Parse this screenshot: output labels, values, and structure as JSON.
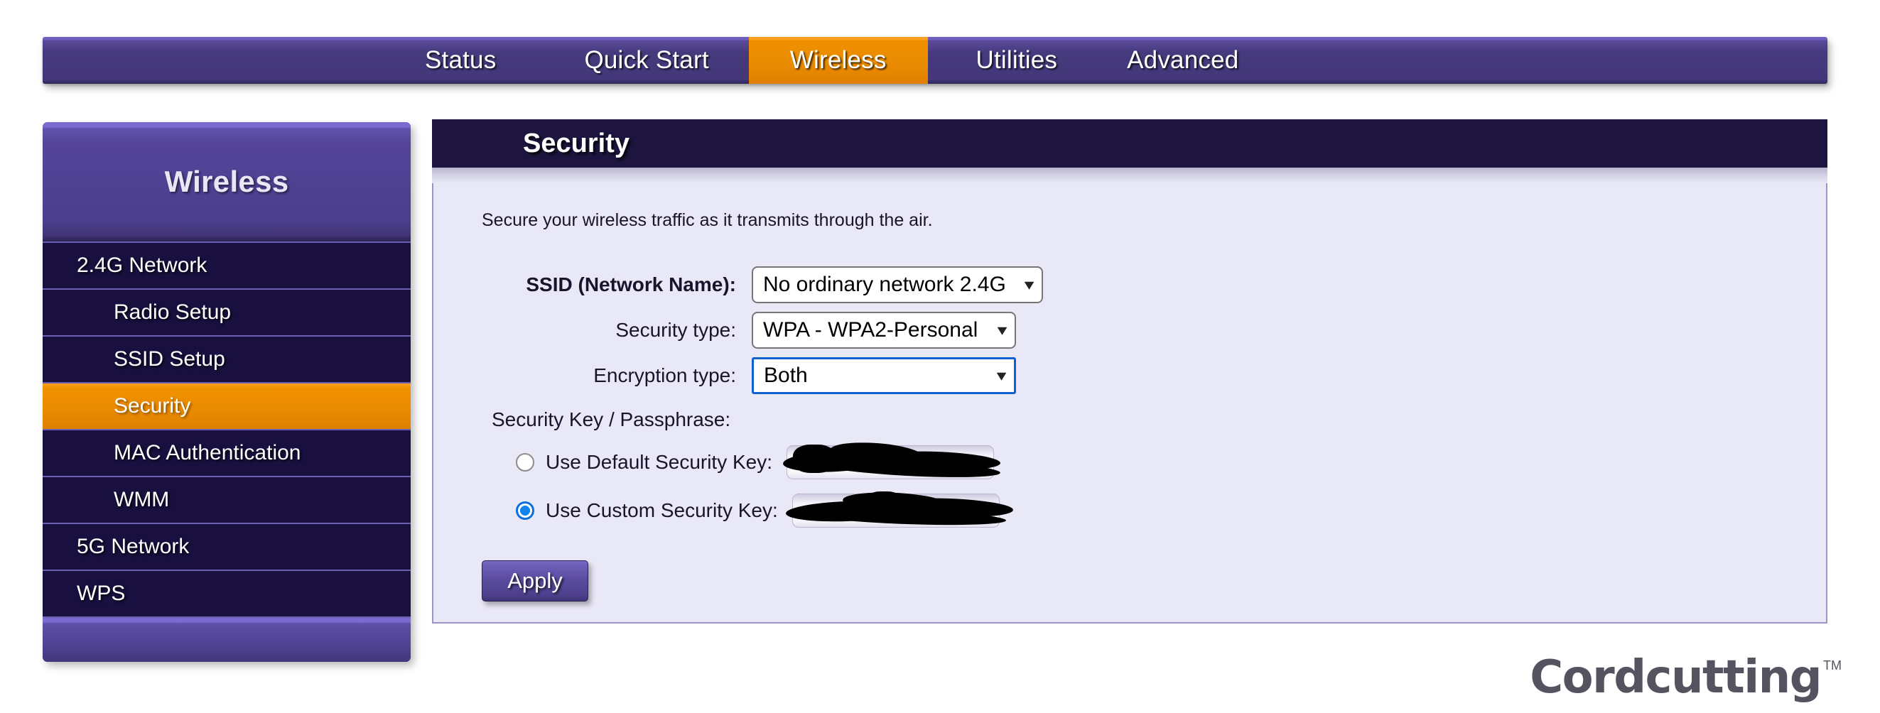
{
  "topnav": {
    "tabs": [
      {
        "label": "Status",
        "active": false
      },
      {
        "label": "Quick Start",
        "active": false
      },
      {
        "label": "Wireless",
        "active": true
      },
      {
        "label": "Utilities",
        "active": false
      },
      {
        "label": "Advanced",
        "active": false
      }
    ]
  },
  "sidebar": {
    "title": "Wireless",
    "items": [
      {
        "label": "2.4G Network",
        "level": 1,
        "active": false
      },
      {
        "label": "Radio Setup",
        "level": 2,
        "active": false
      },
      {
        "label": "SSID Setup",
        "level": 2,
        "active": false
      },
      {
        "label": "Security",
        "level": 2,
        "active": true
      },
      {
        "label": "MAC Authentication",
        "level": 2,
        "active": false
      },
      {
        "label": "WMM",
        "level": 2,
        "active": false
      },
      {
        "label": "5G Network",
        "level": 1,
        "active": false
      },
      {
        "label": "WPS",
        "level": 1,
        "active": false
      }
    ]
  },
  "panel": {
    "header_title": "Security",
    "intro": "Secure your wireless traffic as it transmits through the air.",
    "fields": {
      "ssid_label": "SSID (Network Name):",
      "ssid_value": "No ordinary network 2.4G",
      "security_type_label": "Security type:",
      "security_type_value": "WPA - WPA2-Personal",
      "encryption_type_label": "Encryption type:",
      "encryption_type_value": "Both",
      "key_heading": "Security Key / Passphrase:",
      "default_key_label": "Use Default Security Key:",
      "default_key_value": "",
      "custom_key_label": "Use Custom Security Key:",
      "custom_key_value": "",
      "selected_key_option": "custom"
    },
    "apply_label": "Apply"
  },
  "logo": {
    "text": "Cordcutting",
    "trademark": "TM"
  },
  "colors": {
    "nav_purple": "#463a7d",
    "accent_orange": "#e98b02",
    "panel_header": "#1d153f",
    "panel_bg": "#e9e8f7",
    "sidebar_item": "#191040",
    "focus_blue": "#1060d0"
  },
  "icons": {
    "chevron_down": "⌄"
  }
}
